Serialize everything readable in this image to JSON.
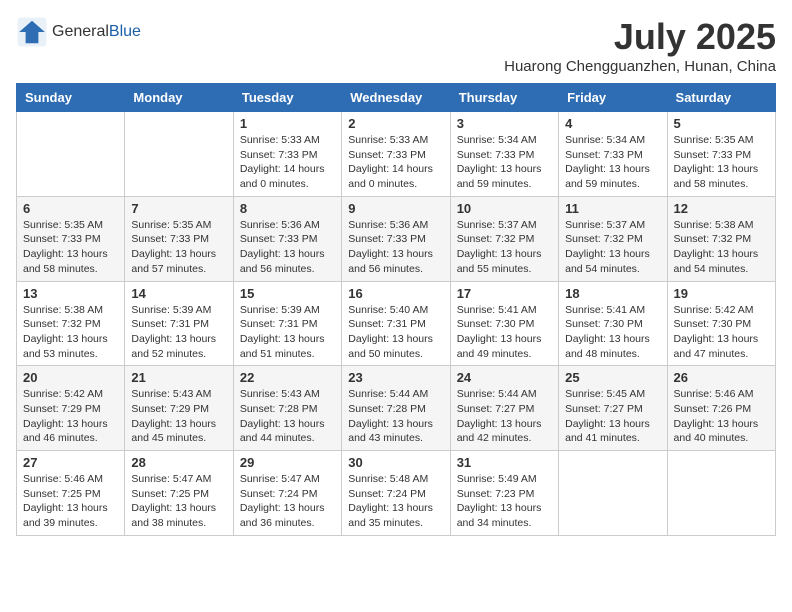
{
  "header": {
    "logo_general": "General",
    "logo_blue": "Blue",
    "month_title": "July 2025",
    "location": "Huarong Chengguanzhen, Hunan, China"
  },
  "weekdays": [
    "Sunday",
    "Monday",
    "Tuesday",
    "Wednesday",
    "Thursday",
    "Friday",
    "Saturday"
  ],
  "weeks": [
    [
      {
        "day": "",
        "info": ""
      },
      {
        "day": "",
        "info": ""
      },
      {
        "day": "1",
        "info": "Sunrise: 5:33 AM\nSunset: 7:33 PM\nDaylight: 14 hours\nand 0 minutes."
      },
      {
        "day": "2",
        "info": "Sunrise: 5:33 AM\nSunset: 7:33 PM\nDaylight: 14 hours\nand 0 minutes."
      },
      {
        "day": "3",
        "info": "Sunrise: 5:34 AM\nSunset: 7:33 PM\nDaylight: 13 hours\nand 59 minutes."
      },
      {
        "day": "4",
        "info": "Sunrise: 5:34 AM\nSunset: 7:33 PM\nDaylight: 13 hours\nand 59 minutes."
      },
      {
        "day": "5",
        "info": "Sunrise: 5:35 AM\nSunset: 7:33 PM\nDaylight: 13 hours\nand 58 minutes."
      }
    ],
    [
      {
        "day": "6",
        "info": "Sunrise: 5:35 AM\nSunset: 7:33 PM\nDaylight: 13 hours\nand 58 minutes."
      },
      {
        "day": "7",
        "info": "Sunrise: 5:35 AM\nSunset: 7:33 PM\nDaylight: 13 hours\nand 57 minutes."
      },
      {
        "day": "8",
        "info": "Sunrise: 5:36 AM\nSunset: 7:33 PM\nDaylight: 13 hours\nand 56 minutes."
      },
      {
        "day": "9",
        "info": "Sunrise: 5:36 AM\nSunset: 7:33 PM\nDaylight: 13 hours\nand 56 minutes."
      },
      {
        "day": "10",
        "info": "Sunrise: 5:37 AM\nSunset: 7:32 PM\nDaylight: 13 hours\nand 55 minutes."
      },
      {
        "day": "11",
        "info": "Sunrise: 5:37 AM\nSunset: 7:32 PM\nDaylight: 13 hours\nand 54 minutes."
      },
      {
        "day": "12",
        "info": "Sunrise: 5:38 AM\nSunset: 7:32 PM\nDaylight: 13 hours\nand 54 minutes."
      }
    ],
    [
      {
        "day": "13",
        "info": "Sunrise: 5:38 AM\nSunset: 7:32 PM\nDaylight: 13 hours\nand 53 minutes."
      },
      {
        "day": "14",
        "info": "Sunrise: 5:39 AM\nSunset: 7:31 PM\nDaylight: 13 hours\nand 52 minutes."
      },
      {
        "day": "15",
        "info": "Sunrise: 5:39 AM\nSunset: 7:31 PM\nDaylight: 13 hours\nand 51 minutes."
      },
      {
        "day": "16",
        "info": "Sunrise: 5:40 AM\nSunset: 7:31 PM\nDaylight: 13 hours\nand 50 minutes."
      },
      {
        "day": "17",
        "info": "Sunrise: 5:41 AM\nSunset: 7:30 PM\nDaylight: 13 hours\nand 49 minutes."
      },
      {
        "day": "18",
        "info": "Sunrise: 5:41 AM\nSunset: 7:30 PM\nDaylight: 13 hours\nand 48 minutes."
      },
      {
        "day": "19",
        "info": "Sunrise: 5:42 AM\nSunset: 7:30 PM\nDaylight: 13 hours\nand 47 minutes."
      }
    ],
    [
      {
        "day": "20",
        "info": "Sunrise: 5:42 AM\nSunset: 7:29 PM\nDaylight: 13 hours\nand 46 minutes."
      },
      {
        "day": "21",
        "info": "Sunrise: 5:43 AM\nSunset: 7:29 PM\nDaylight: 13 hours\nand 45 minutes."
      },
      {
        "day": "22",
        "info": "Sunrise: 5:43 AM\nSunset: 7:28 PM\nDaylight: 13 hours\nand 44 minutes."
      },
      {
        "day": "23",
        "info": "Sunrise: 5:44 AM\nSunset: 7:28 PM\nDaylight: 13 hours\nand 43 minutes."
      },
      {
        "day": "24",
        "info": "Sunrise: 5:44 AM\nSunset: 7:27 PM\nDaylight: 13 hours\nand 42 minutes."
      },
      {
        "day": "25",
        "info": "Sunrise: 5:45 AM\nSunset: 7:27 PM\nDaylight: 13 hours\nand 41 minutes."
      },
      {
        "day": "26",
        "info": "Sunrise: 5:46 AM\nSunset: 7:26 PM\nDaylight: 13 hours\nand 40 minutes."
      }
    ],
    [
      {
        "day": "27",
        "info": "Sunrise: 5:46 AM\nSunset: 7:25 PM\nDaylight: 13 hours\nand 39 minutes."
      },
      {
        "day": "28",
        "info": "Sunrise: 5:47 AM\nSunset: 7:25 PM\nDaylight: 13 hours\nand 38 minutes."
      },
      {
        "day": "29",
        "info": "Sunrise: 5:47 AM\nSunset: 7:24 PM\nDaylight: 13 hours\nand 36 minutes."
      },
      {
        "day": "30",
        "info": "Sunrise: 5:48 AM\nSunset: 7:24 PM\nDaylight: 13 hours\nand 35 minutes."
      },
      {
        "day": "31",
        "info": "Sunrise: 5:49 AM\nSunset: 7:23 PM\nDaylight: 13 hours\nand 34 minutes."
      },
      {
        "day": "",
        "info": ""
      },
      {
        "day": "",
        "info": ""
      }
    ]
  ]
}
